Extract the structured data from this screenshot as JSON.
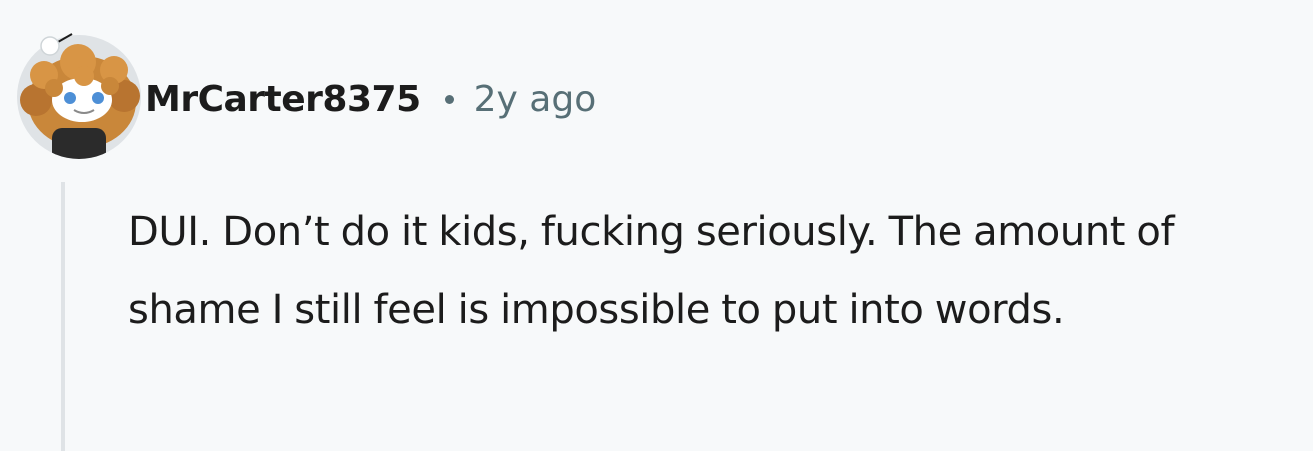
{
  "comment": {
    "author": "MrCarter8375",
    "timestamp": "2y ago",
    "body": "DUI. Don’t do it kids, fucking seriously. The amount of shame I still feel is impossible to put into words."
  },
  "avatar": {
    "icon": "snoo-avatar-icon"
  },
  "colors": {
    "background": "#f7f9fa",
    "text": "#1c1c1c",
    "meta_text": "#576f76",
    "separator_dot": "#576f76",
    "thread_line": "#dfe3e6",
    "avatar_bg": "#dfe3e6",
    "avatar_hair": "#c9873a",
    "avatar_eye": "#4d8fd6"
  }
}
